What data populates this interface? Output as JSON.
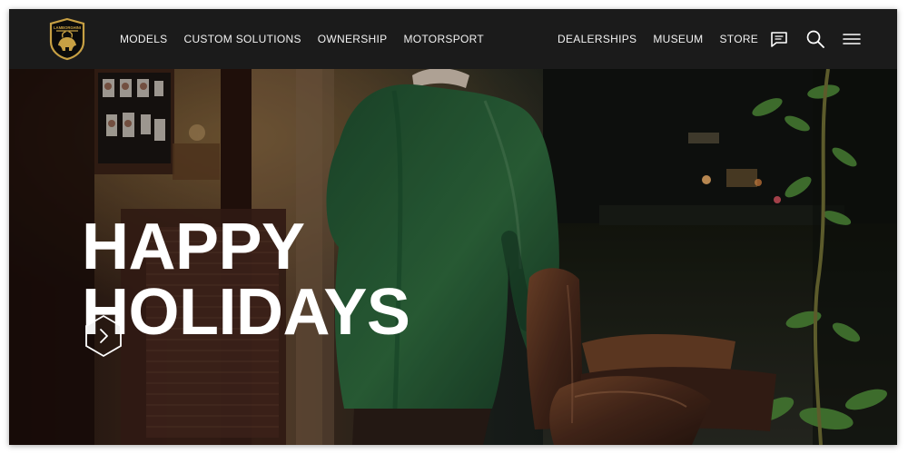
{
  "brand": {
    "logo_icon": "lamborghini-bull-shield",
    "logo_text": "LAMBORGHINI",
    "logo_gold": "#c7a044"
  },
  "nav": {
    "left_items": [
      {
        "label": "MODELS"
      },
      {
        "label": "CUSTOM SOLUTIONS"
      },
      {
        "label": "OWNERSHIP"
      },
      {
        "label": "MOTORSPORT"
      }
    ],
    "right_items": [
      {
        "label": "DEALERSHIPS"
      },
      {
        "label": "MUSEUM"
      },
      {
        "label": "STORE"
      }
    ],
    "icons": [
      {
        "name": "chat-icon"
      },
      {
        "name": "search-icon"
      },
      {
        "name": "menu-icon"
      }
    ],
    "background": "#1b1b1b",
    "text_color": "#f2f2f2"
  },
  "hero": {
    "title_line_1": "HAPPY",
    "title_line_2": "HOLIDAYS",
    "next_icon": "chevron-right-icon",
    "accent_green": "#2f6b3e"
  }
}
